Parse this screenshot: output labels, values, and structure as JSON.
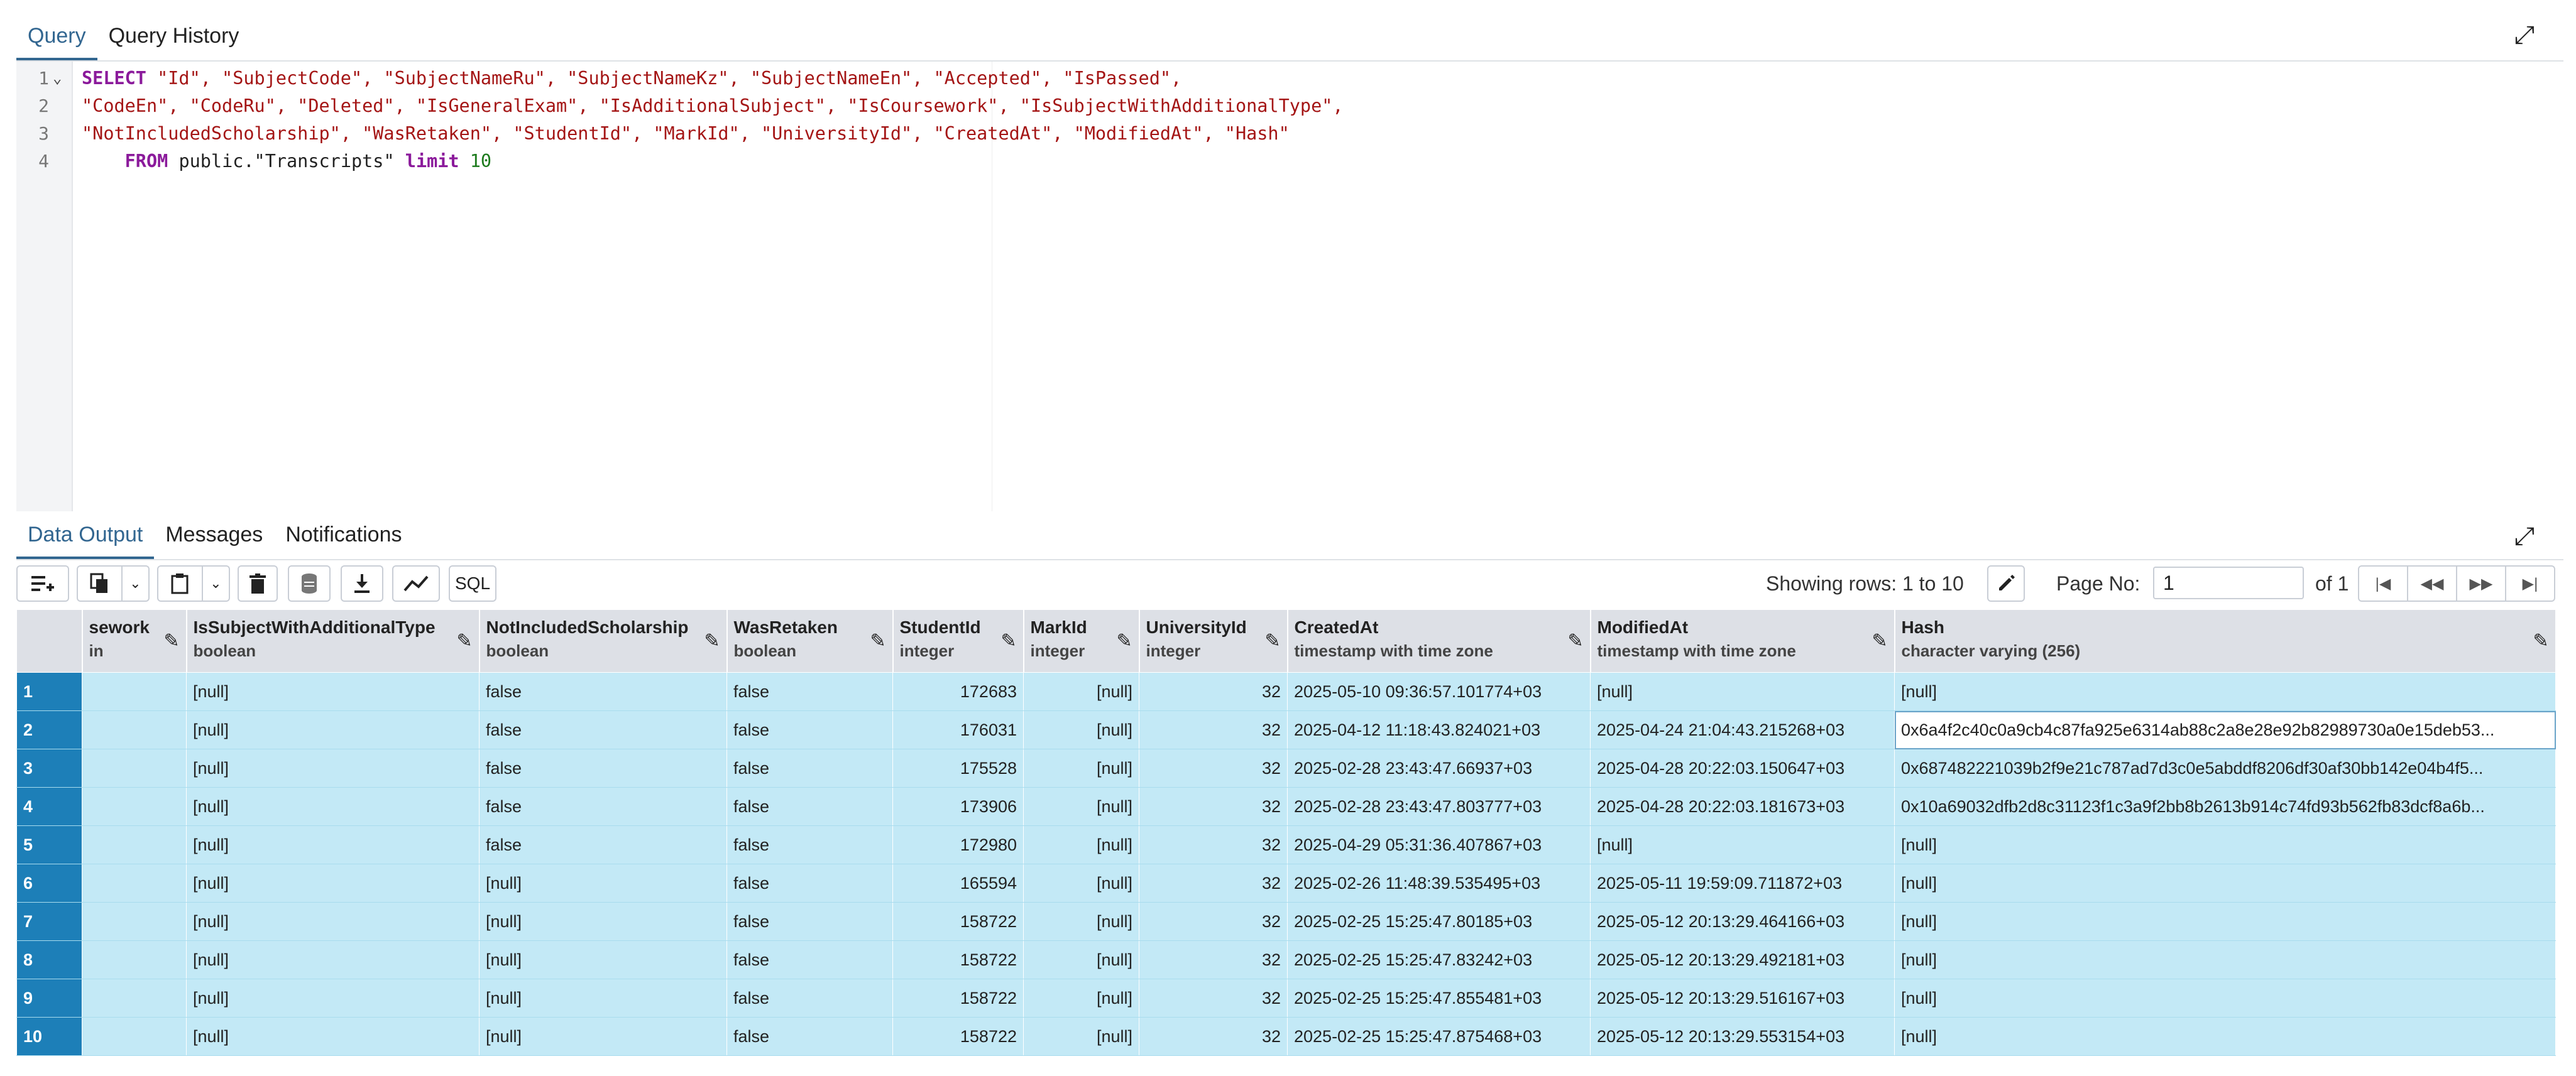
{
  "tabs": {
    "query": "Query",
    "history": "Query History",
    "data_output": "Data Output",
    "messages": "Messages",
    "notifications": "Notifications"
  },
  "editor": {
    "line_numbers": [
      "1",
      "2",
      "3",
      "4"
    ],
    "line1": {
      "kw": "SELECT",
      "rest": " \"Id\", \"SubjectCode\", \"SubjectNameRu\", \"SubjectNameKz\", \"SubjectNameEn\", \"Accepted\", \"IsPassed\","
    },
    "line2": "\"CodeEn\", \"CodeRu\", \"Deleted\", \"IsGeneralExam\", \"IsAdditionalSubject\", \"IsCoursework\", \"IsSubjectWithAdditionalType\",",
    "line3": "\"NotIncludedScholarship\", \"WasRetaken\", \"StudentId\", \"MarkId\", \"UniversityId\", \"CreatedAt\", \"ModifiedAt\", \"Hash\"",
    "line4": {
      "kw_from": "FROM",
      "table": " public.\"Transcripts\" ",
      "kw_limit": "limit",
      "num": " 10"
    }
  },
  "toolbar": {
    "sql_label": "SQL",
    "showing_rows": "Showing rows: 1 to 10",
    "page_no_label": "Page No:",
    "page_no_value": "1",
    "of_pages": "of 1"
  },
  "columns": [
    {
      "name": "sework",
      "type": "in"
    },
    {
      "name": "IsSubjectWithAdditionalType",
      "type": "boolean"
    },
    {
      "name": "NotIncludedScholarship",
      "type": "boolean"
    },
    {
      "name": "WasRetaken",
      "type": "boolean"
    },
    {
      "name": "StudentId",
      "type": "integer"
    },
    {
      "name": "MarkId",
      "type": "integer"
    },
    {
      "name": "UniversityId",
      "type": "integer"
    },
    {
      "name": "CreatedAt",
      "type": "timestamp with time zone"
    },
    {
      "name": "ModifiedAt",
      "type": "timestamp with time zone"
    },
    {
      "name": "Hash",
      "type": "character varying (256)"
    }
  ],
  "rows": [
    [
      "1",
      "",
      "[null]",
      "false",
      "false",
      "172683",
      "[null]",
      "32",
      "2025-05-10 09:36:57.101774+03",
      "[null]",
      "[null]"
    ],
    [
      "2",
      "",
      "[null]",
      "false",
      "false",
      "176031",
      "[null]",
      "32",
      "2025-04-12 11:18:43.824021+03",
      "2025-04-24 21:04:43.215268+03",
      "0x6a4f2c40c0a9cb4c87fa925e6314ab88c2a8e28e92b82989730a0e15deb53..."
    ],
    [
      "3",
      "",
      "[null]",
      "false",
      "false",
      "175528",
      "[null]",
      "32",
      "2025-02-28 23:43:47.66937+03",
      "2025-04-28 20:22:03.150647+03",
      "0x687482221039b2f9e21c787ad7d3c0e5abddf8206df30af30bb142e04b4f5..."
    ],
    [
      "4",
      "",
      "[null]",
      "false",
      "false",
      "173906",
      "[null]",
      "32",
      "2025-02-28 23:43:47.803777+03",
      "2025-04-28 20:22:03.181673+03",
      "0x10a69032dfb2d8c31123f1c3a9f2bb8b2613b914c74fd93b562fb83dcf8a6b..."
    ],
    [
      "5",
      "",
      "[null]",
      "false",
      "false",
      "172980",
      "[null]",
      "32",
      "2025-04-29 05:31:36.407867+03",
      "[null]",
      "[null]"
    ],
    [
      "6",
      "",
      "[null]",
      "[null]",
      "false",
      "165594",
      "[null]",
      "32",
      "2025-02-26 11:48:39.535495+03",
      "2025-05-11 19:59:09.711872+03",
      "[null]"
    ],
    [
      "7",
      "",
      "[null]",
      "[null]",
      "false",
      "158722",
      "[null]",
      "32",
      "2025-02-25 15:25:47.80185+03",
      "2025-05-12 20:13:29.464166+03",
      "[null]"
    ],
    [
      "8",
      "",
      "[null]",
      "[null]",
      "false",
      "158722",
      "[null]",
      "32",
      "2025-02-25 15:25:47.83242+03",
      "2025-05-12 20:13:29.492181+03",
      "[null]"
    ],
    [
      "9",
      "",
      "[null]",
      "[null]",
      "false",
      "158722",
      "[null]",
      "32",
      "2025-02-25 15:25:47.855481+03",
      "2025-05-12 20:13:29.516167+03",
      "[null]"
    ],
    [
      "10",
      "",
      "[null]",
      "[null]",
      "false",
      "158722",
      "[null]",
      "32",
      "2025-02-25 15:25:47.875468+03",
      "2025-05-12 20:13:29.553154+03",
      "[null]"
    ]
  ],
  "icons": {
    "expand": "expand-icon",
    "add_row": "add-row-icon",
    "copy": "copy-icon",
    "paste": "paste-icon",
    "delete": "delete-icon",
    "save_data": "save-data-icon",
    "download": "download-icon",
    "graph": "graph-icon",
    "edit": "pencil-icon"
  }
}
